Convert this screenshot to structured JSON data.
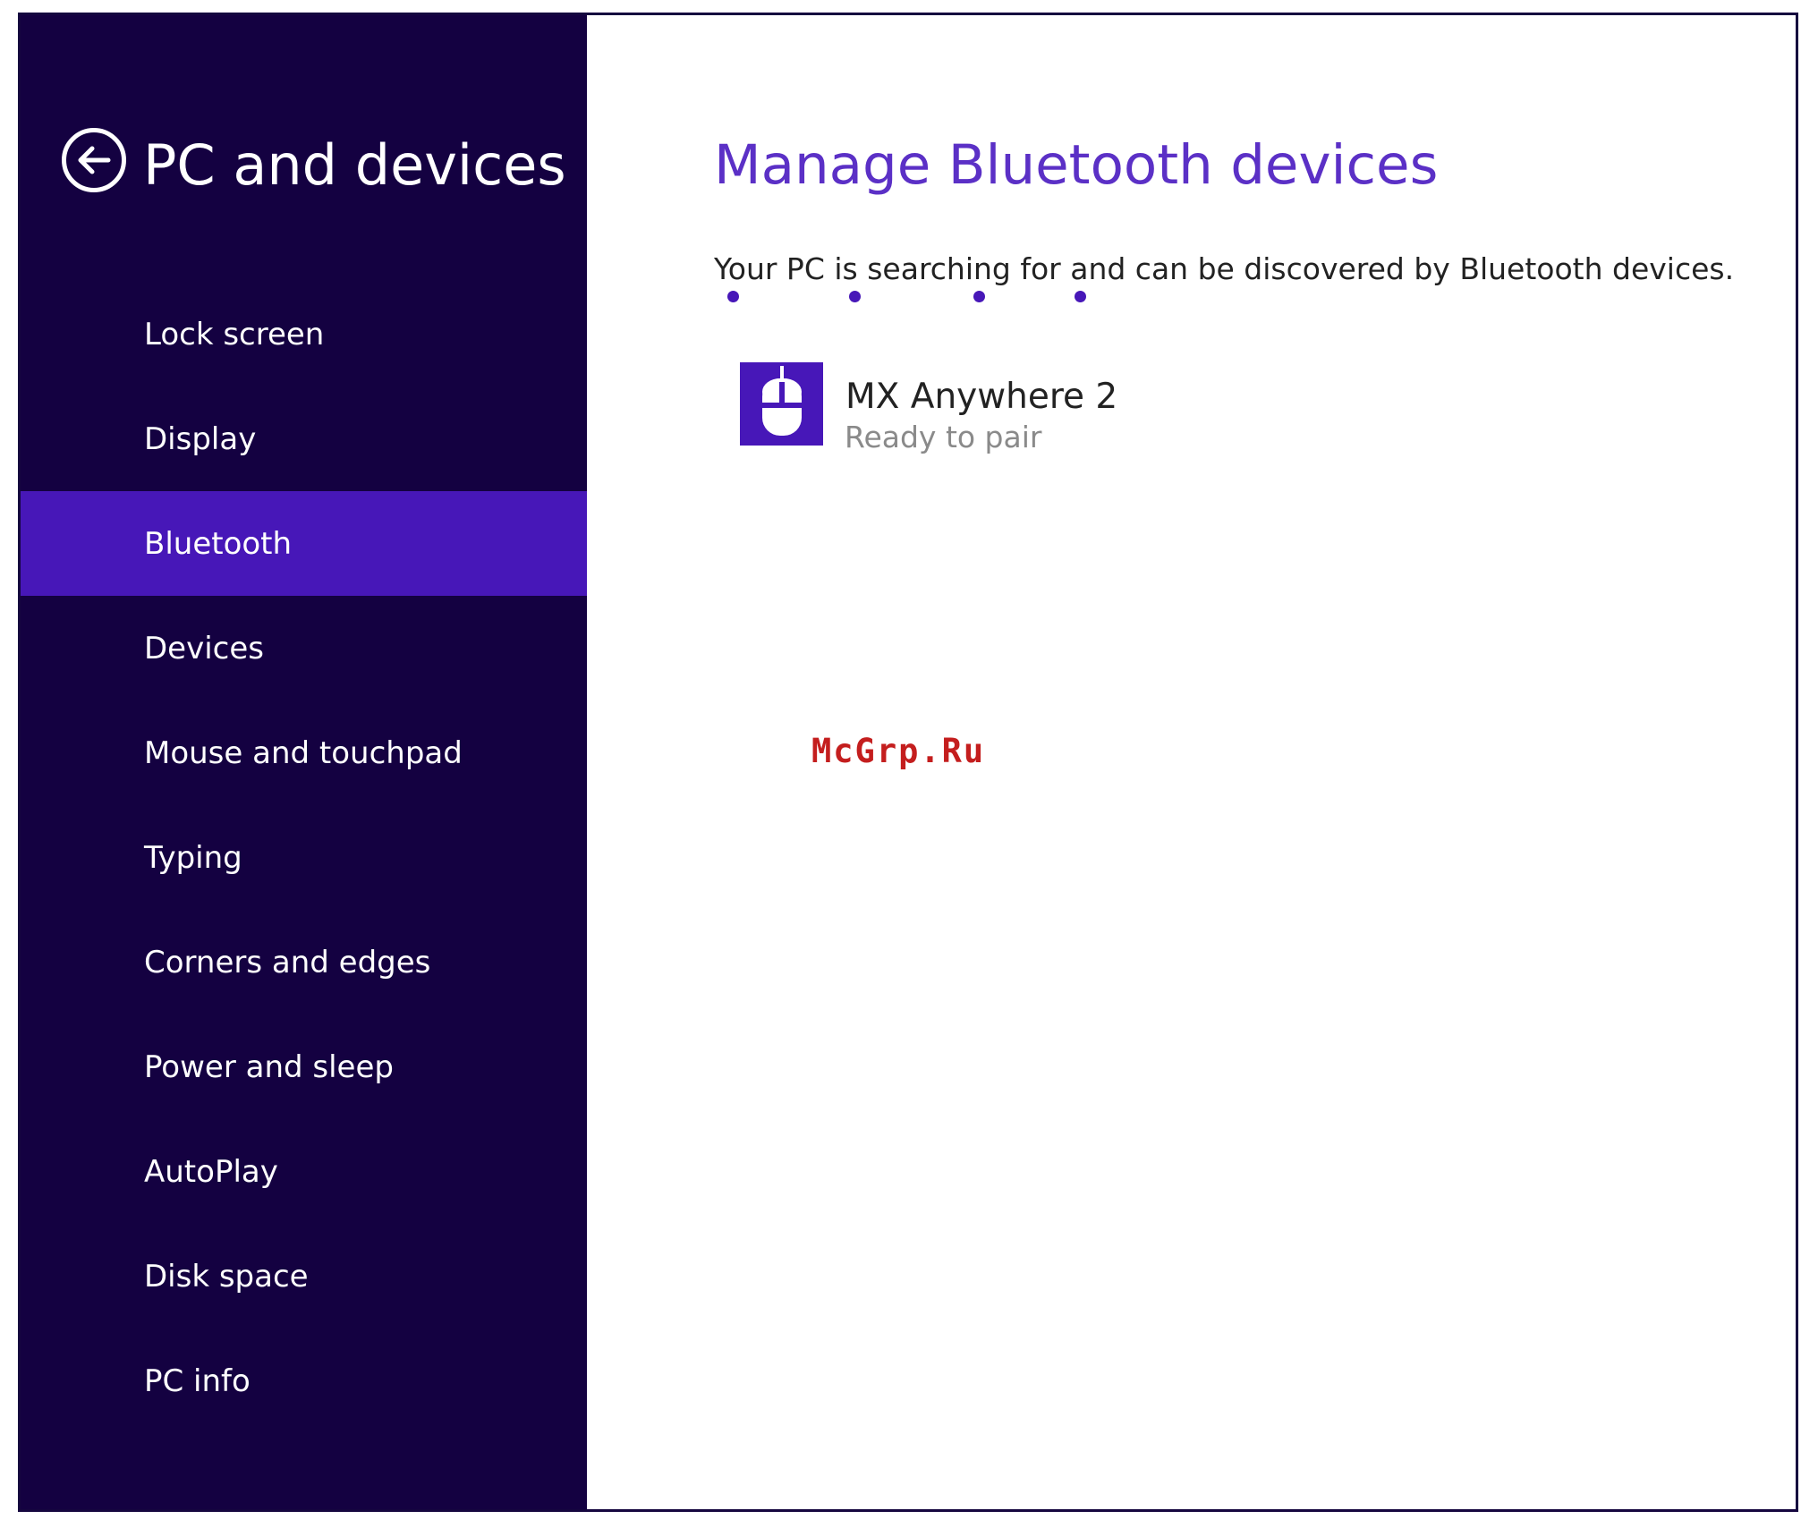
{
  "sidebar": {
    "title": "PC and devices",
    "back_icon": "back-arrow-circle-icon",
    "items": [
      {
        "label": "Lock screen",
        "selected": false
      },
      {
        "label": "Display",
        "selected": false
      },
      {
        "label": "Bluetooth",
        "selected": true
      },
      {
        "label": "Devices",
        "selected": false
      },
      {
        "label": "Mouse and touchpad",
        "selected": false
      },
      {
        "label": "Typing",
        "selected": false
      },
      {
        "label": "Corners and edges",
        "selected": false
      },
      {
        "label": "Power and sleep",
        "selected": false
      },
      {
        "label": "AutoPlay",
        "selected": false
      },
      {
        "label": "Disk space",
        "selected": false
      },
      {
        "label": "PC info",
        "selected": false
      }
    ]
  },
  "main": {
    "title": "Manage Bluetooth devices",
    "status": "Your PC is searching for and can be discovered by Bluetooth devices.",
    "devices": [
      {
        "name": "MX Anywhere 2",
        "status": "Ready to pair",
        "icon": "mouse-icon"
      }
    ]
  },
  "watermark": "McGrp.Ru",
  "colors": {
    "sidebar_bg": "#140141",
    "accent": "#4717b8",
    "title": "#5b30c6",
    "watermark": "#c41e1e"
  }
}
